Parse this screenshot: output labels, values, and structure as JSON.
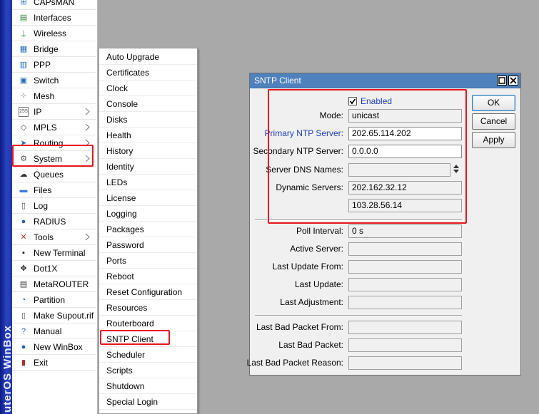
{
  "brand": {
    "text": "uterOS WinBox"
  },
  "main_menu": {
    "items": [
      {
        "label": "CAPsMAN",
        "icon": "capsman-icon",
        "glyph": "⊞",
        "color": "#2a6fbf"
      },
      {
        "label": "Interfaces",
        "icon": "interfaces-icon",
        "glyph": "▤",
        "color": "#2e7d32"
      },
      {
        "label": "Wireless",
        "icon": "wireless-icon",
        "glyph": "⍊",
        "color": "#2e7d32"
      },
      {
        "label": "Bridge",
        "icon": "bridge-icon",
        "glyph": "▦",
        "color": "#2a6fbf"
      },
      {
        "label": "PPP",
        "icon": "ppp-icon",
        "glyph": "▥",
        "color": "#2a6fbf"
      },
      {
        "label": "Switch",
        "icon": "switch-icon",
        "glyph": "▣",
        "color": "#2a6fbf"
      },
      {
        "label": "Mesh",
        "icon": "mesh-icon",
        "glyph": "⁘",
        "color": "#1a1a1a"
      },
      {
        "label": "IP",
        "icon": "ip-icon",
        "glyph": "255",
        "color": "#555555",
        "arrow": true
      },
      {
        "label": "MPLS",
        "icon": "mpls-icon",
        "glyph": "◇",
        "color": "#555555",
        "arrow": true
      },
      {
        "label": "Routing",
        "icon": "routing-icon",
        "glyph": "➤",
        "color": "#2a6fbf",
        "arrow": true
      },
      {
        "label": "System",
        "icon": "system-gear-icon",
        "glyph": "⚙",
        "color": "#555555",
        "arrow": true
      },
      {
        "label": "Queues",
        "icon": "queues-icon",
        "glyph": "☁",
        "color": "#333333"
      },
      {
        "label": "Files",
        "icon": "files-icon",
        "glyph": "▬",
        "color": "#3b7dd8"
      },
      {
        "label": "Log",
        "icon": "log-icon",
        "glyph": "▯",
        "color": "#555555"
      },
      {
        "label": "RADIUS",
        "icon": "radius-icon",
        "glyph": "●",
        "color": "#2d5fb0"
      },
      {
        "label": "Tools",
        "icon": "tools-icon",
        "glyph": "✕",
        "color": "#c0392b",
        "arrow": true
      },
      {
        "label": "New Terminal",
        "icon": "terminal-icon",
        "glyph": "▪",
        "color": "#222222"
      },
      {
        "label": "Dot1X",
        "icon": "dot1x-icon",
        "glyph": "✥",
        "color": "#222222"
      },
      {
        "label": "MetaROUTER",
        "icon": "metarouter-icon",
        "glyph": "▤",
        "color": "#333333"
      },
      {
        "label": "Partition",
        "icon": "partition-icon",
        "glyph": "◔",
        "color": "#2d5fb0"
      },
      {
        "label": "Make Supout.rif",
        "icon": "supout-icon",
        "glyph": "▯",
        "color": "#555555"
      },
      {
        "label": "Manual",
        "icon": "manual-icon",
        "glyph": "?",
        "color": "#1f5fbf"
      },
      {
        "label": "New WinBox",
        "icon": "winbox-icon",
        "glyph": "●",
        "color": "#1f5fbf"
      },
      {
        "label": "Exit",
        "icon": "exit-icon",
        "glyph": "▮",
        "color": "#b03030"
      }
    ]
  },
  "sub_menu": {
    "items": [
      "Auto Upgrade",
      "Certificates",
      "Clock",
      "Console",
      "Disks",
      "Health",
      "History",
      "Identity",
      "LEDs",
      "License",
      "Logging",
      "Packages",
      "Password",
      "Ports",
      "Reboot",
      "Reset Configuration",
      "Resources",
      "Routerboard",
      "SNTP Client",
      "Scheduler",
      "Scripts",
      "Shutdown",
      "Special Login"
    ]
  },
  "dialog": {
    "title": "SNTP Client",
    "enabled_label": "Enabled",
    "enabled": true,
    "fields": {
      "mode": {
        "label": "Mode:",
        "value": "unicast"
      },
      "primary_ntp": {
        "label": "Primary NTP Server:",
        "value": "202.65.114.202"
      },
      "secondary_ntp": {
        "label": "Secondary NTP Server:",
        "value": "0.0.0.0"
      },
      "server_dns": {
        "label": "Server DNS Names:",
        "value": ""
      },
      "dynamic_servers": {
        "label": "Dynamic Servers:",
        "value": "202.162.32.12",
        "value2": "103.28.56.14"
      },
      "poll_interval": {
        "label": "Poll Interval:",
        "value": "0 s"
      },
      "active_server": {
        "label": "Active Server:",
        "value": ""
      },
      "last_update_from": {
        "label": "Last Update From:",
        "value": ""
      },
      "last_update": {
        "label": "Last Update:",
        "value": ""
      },
      "last_adjustment": {
        "label": "Last Adjustment:",
        "value": ""
      },
      "last_bad_packet_from": {
        "label": "Last Bad Packet From:",
        "value": ""
      },
      "last_bad_packet": {
        "label": "Last Bad Packet:",
        "value": ""
      },
      "last_bad_packet_reason": {
        "label": "Last Bad Packet Reason:",
        "value": ""
      }
    },
    "buttons": {
      "ok": "OK",
      "cancel": "Cancel",
      "apply": "Apply"
    }
  },
  "colors": {
    "titlebar": "#4f81bd",
    "primary_label": "#1f3fbf",
    "annotation": "#e8151b"
  }
}
